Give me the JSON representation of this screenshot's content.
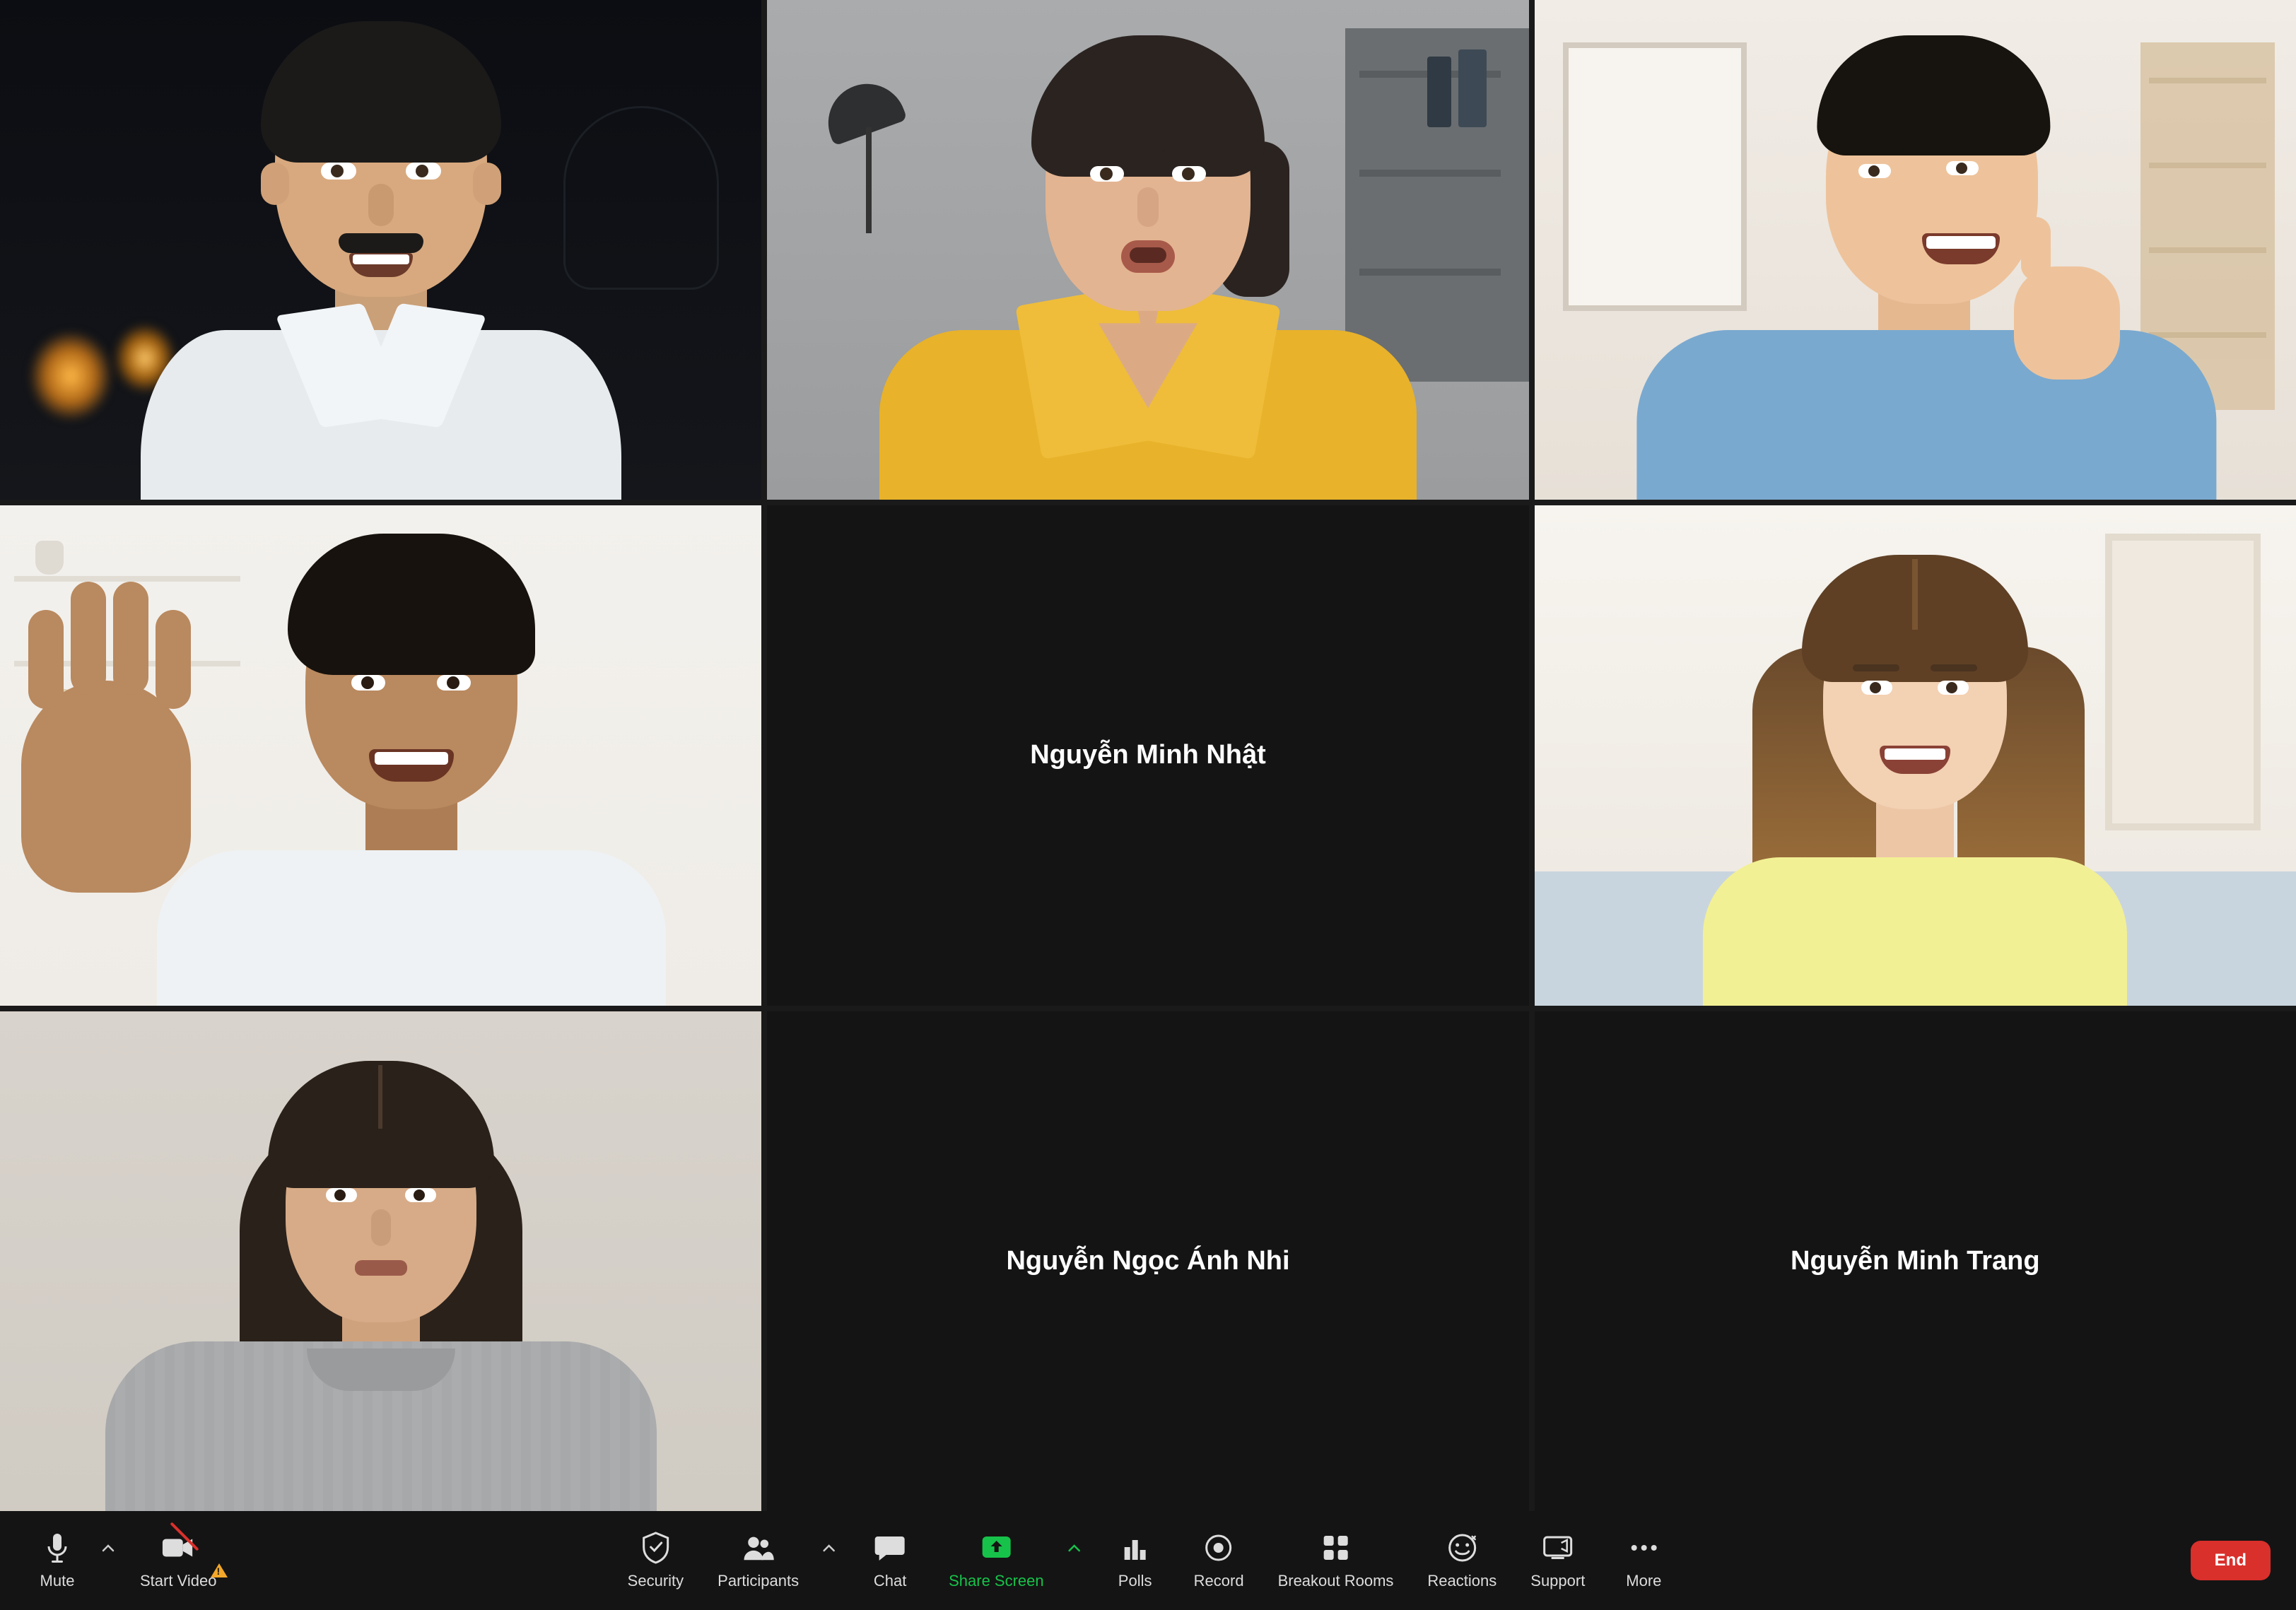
{
  "participants": [
    {
      "video_on": true,
      "name": ""
    },
    {
      "video_on": true,
      "name": ""
    },
    {
      "video_on": true,
      "name": ""
    },
    {
      "video_on": true,
      "name": ""
    },
    {
      "video_on": false,
      "name": "Nguyễn Minh Nhật"
    },
    {
      "video_on": true,
      "name": ""
    },
    {
      "video_on": true,
      "name": ""
    },
    {
      "video_on": false,
      "name": "Nguyễn Ngọc Ánh Nhi"
    },
    {
      "video_on": false,
      "name": "Nguyễn Minh Trang"
    }
  ],
  "toolbar": {
    "mute": "Mute",
    "start_video": "Start Video",
    "security": "Security",
    "participants": "Participants",
    "chat": "Chat",
    "share_screen": "Share Screen",
    "polls": "Polls",
    "record": "Record",
    "breakout_rooms": "Breakout Rooms",
    "reactions": "Reactions",
    "support": "Support",
    "more": "More",
    "end": "End"
  },
  "colors": {
    "share_green": "#17c24a",
    "end_red": "#d9302c",
    "warning": "#f2a72a"
  }
}
